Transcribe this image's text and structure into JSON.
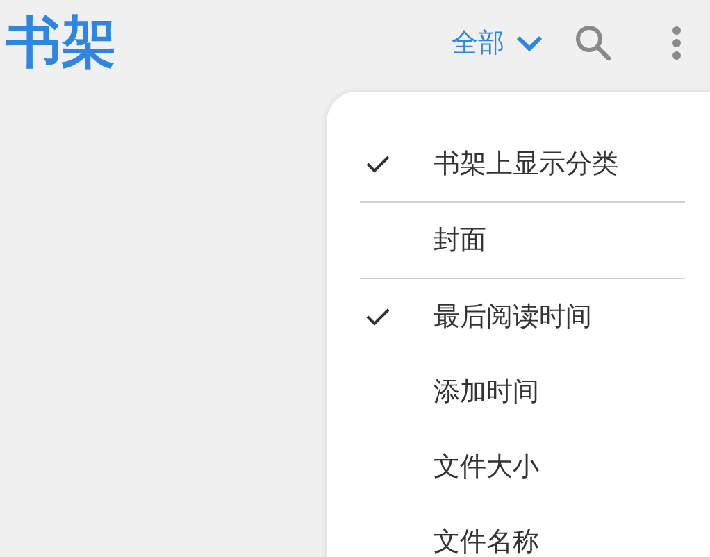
{
  "app_bar": {
    "title": "书架",
    "filter": "全部"
  },
  "menu": {
    "sections": [
      [
        {
          "label": "书架上显示分类",
          "checked": true
        }
      ],
      [
        {
          "label": "封面",
          "checked": false
        }
      ],
      [
        {
          "label": "最后阅读时间",
          "checked": true
        },
        {
          "label": "添加时间",
          "checked": false
        },
        {
          "label": "文件大小",
          "checked": false
        },
        {
          "label": "文件名称",
          "checked": false
        }
      ]
    ]
  }
}
